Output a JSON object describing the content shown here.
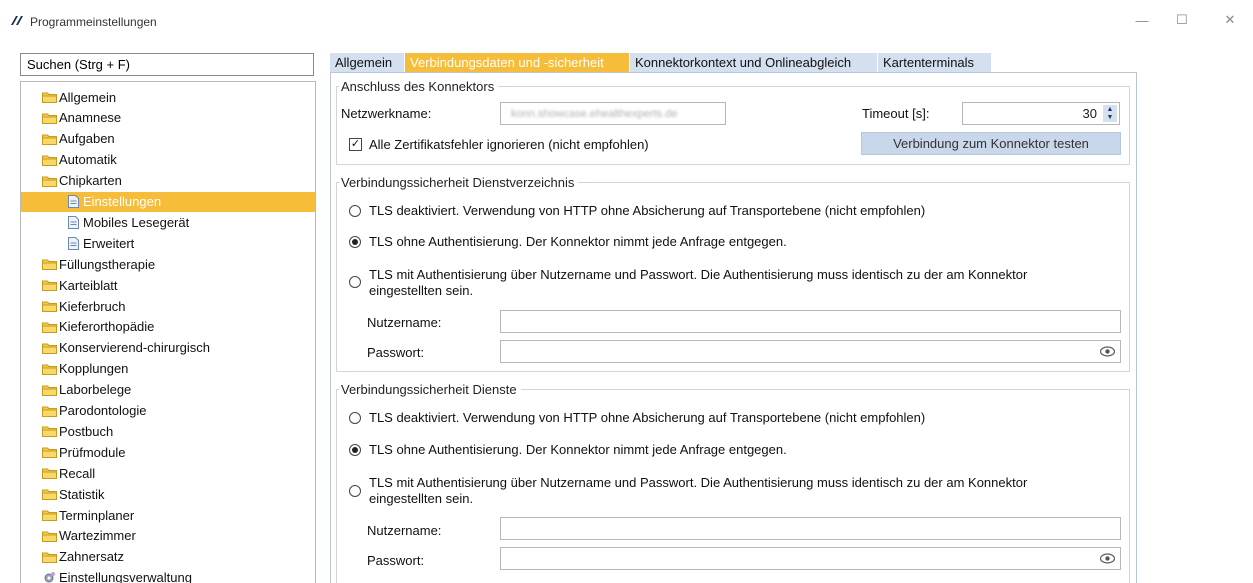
{
  "window": {
    "title": "Programmeinstellungen",
    "minimize_glyph": "—",
    "maximize_glyph": "☐",
    "close_glyph": "✕"
  },
  "sidebar": {
    "search_value": "Suchen (Strg + F)",
    "items": [
      {
        "label": "Allgemein",
        "icon": "folder-icon"
      },
      {
        "label": "Anamnese",
        "icon": "folder-icon"
      },
      {
        "label": "Aufgaben",
        "icon": "folder-icon"
      },
      {
        "label": "Automatik",
        "icon": "folder-icon"
      },
      {
        "label": "Chipkarten",
        "icon": "folder-open-icon"
      },
      {
        "label": "Einstellungen",
        "icon": "document-icon",
        "selected": true
      },
      {
        "label": "Mobiles Lesegerät",
        "icon": "document-icon"
      },
      {
        "label": "Erweitert",
        "icon": "document-icon"
      },
      {
        "label": "Füllungstherapie",
        "icon": "folder-icon"
      },
      {
        "label": "Karteiblatt",
        "icon": "folder-icon"
      },
      {
        "label": "Kieferbruch",
        "icon": "folder-icon"
      },
      {
        "label": "Kieferorthopädie",
        "icon": "folder-icon"
      },
      {
        "label": "Konservierend-chirurgisch",
        "icon": "folder-icon"
      },
      {
        "label": "Kopplungen",
        "icon": "folder-icon"
      },
      {
        "label": "Laborbelege",
        "icon": "folder-icon"
      },
      {
        "label": "Parodontologie",
        "icon": "folder-icon"
      },
      {
        "label": "Postbuch",
        "icon": "folder-icon"
      },
      {
        "label": "Prüfmodule",
        "icon": "folder-icon"
      },
      {
        "label": "Recall",
        "icon": "folder-icon"
      },
      {
        "label": "Statistik",
        "icon": "folder-icon"
      },
      {
        "label": "Terminplaner",
        "icon": "folder-icon"
      },
      {
        "label": "Wartezimmer",
        "icon": "folder-icon"
      },
      {
        "label": "Zahnersatz",
        "icon": "folder-icon"
      },
      {
        "label": "Einstellungsverwaltung",
        "icon": "gear-icon"
      }
    ]
  },
  "tabs": [
    {
      "label": "Allgemein",
      "active": false
    },
    {
      "label": "Verbindungsdaten und -sicherheit",
      "active": true
    },
    {
      "label": "Konnektorkontext und Onlineabgleich",
      "active": false
    },
    {
      "label": "Kartenterminals",
      "active": false
    }
  ],
  "connector": {
    "group_title": "Anschluss des Konnektors",
    "network_label": "Netzwerkname:",
    "network_value": "konn.showcase.ehealthexperts.de",
    "timeout_label": "Timeout [s]:",
    "timeout_value": "30",
    "ignore_cert_label": "Alle Zertifikatsfehler ignorieren (nicht empfohlen)",
    "ignore_cert_checked": true,
    "test_button": "Verbindung zum Konnektor testen"
  },
  "directory_security": {
    "group_title": "Verbindungssicherheit Dienstverzeichnis",
    "option1": "TLS deaktiviert. Verwendung von HTTP ohne Absicherung auf Transportebene (nicht empfohlen)",
    "option2": "TLS ohne Authentisierung. Der Konnektor nimmt jede Anfrage entgegen.",
    "option3_line1": "TLS mit Authentisierung über Nutzername und Passwort. Die Authentisierung muss identisch zu der am Konnektor",
    "option3_line2": "eingestellten sein.",
    "selected_option": 2,
    "username_label": "Nutzername:",
    "username_value": "",
    "password_label": "Passwort:",
    "password_value": ""
  },
  "services_security": {
    "group_title": "Verbindungssicherheit Dienste",
    "option1": "TLS deaktiviert. Verwendung von HTTP ohne Absicherung auf Transportebene (nicht empfohlen)",
    "option2": "TLS ohne Authentisierung. Der Konnektor nimmt jede Anfrage entgegen.",
    "option3_line1": "TLS mit Authentisierung über Nutzername und Passwort. Die Authentisierung muss identisch zu der am Konnektor",
    "option3_line2": "eingestellten sein.",
    "selected_option": 2,
    "username_label": "Nutzername:",
    "username_value": "",
    "password_label": "Passwort:",
    "password_value": ""
  },
  "colors": {
    "accent": "#f5bd3a",
    "tab_inactive": "#d4e0ef",
    "button": "#c9d7ea"
  }
}
